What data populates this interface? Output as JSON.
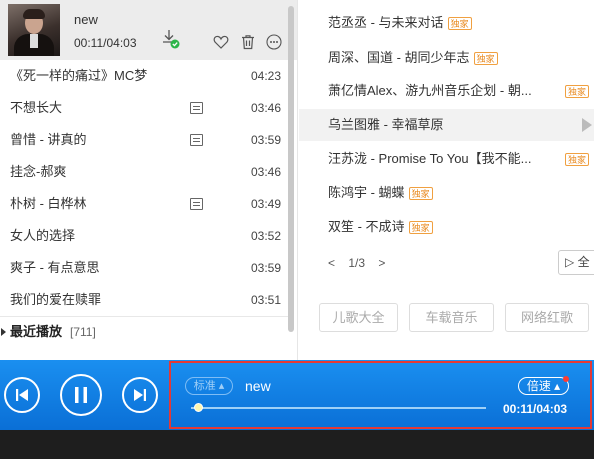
{
  "now_playing": {
    "title": "new",
    "time": "00:11/04:03"
  },
  "playlist": [
    {
      "title": "《死一样的痛过》MC梦",
      "duration": "04:23",
      "mv": false
    },
    {
      "title": "不想长大",
      "duration": "03:46",
      "mv": true
    },
    {
      "title": "曾惜 - 讲真的",
      "duration": "03:59",
      "mv": true
    },
    {
      "title": "挂念-郝爽",
      "duration": "03:46",
      "mv": false
    },
    {
      "title": "朴树 - 白桦林",
      "duration": "03:49",
      "mv": true
    },
    {
      "title": "女人的选择",
      "duration": "03:52",
      "mv": false
    },
    {
      "title": "爽子 - 有点意思",
      "duration": "03:59",
      "mv": false
    },
    {
      "title": "我们的爱在赎罪",
      "duration": "03:51",
      "mv": false
    }
  ],
  "recent": {
    "label": "最近播放",
    "count": "[711]"
  },
  "right_list": [
    {
      "title": "范丞丞 - 与未来对话",
      "badge": "独家"
    },
    {
      "title": "周深、国道 - 胡同少年志",
      "badge": "独家"
    },
    {
      "title": "萧亿情Alex、游九州音乐企划 - 朝...",
      "badge": "独家"
    },
    {
      "title": "乌兰图雅 - 幸福草原",
      "badge": ""
    },
    {
      "title": "汪苏泷 - Promise To You【我不能...",
      "badge": "独家"
    },
    {
      "title": "陈鸿宇 - 蝴蝶",
      "badge": "独家"
    },
    {
      "title": "双笙 - 不成诗",
      "badge": "独家"
    }
  ],
  "pager": {
    "prev": "<",
    "page": "1/3",
    "next": ">"
  },
  "all_button": "▷ 全",
  "tags": [
    "儿歌大全",
    "车载音乐",
    "网络红歌"
  ],
  "player": {
    "mode": "标准 ▴",
    "song": "new",
    "speed": "倍速 ▴",
    "time": "00:11/04:03",
    "progress": 0.04
  }
}
